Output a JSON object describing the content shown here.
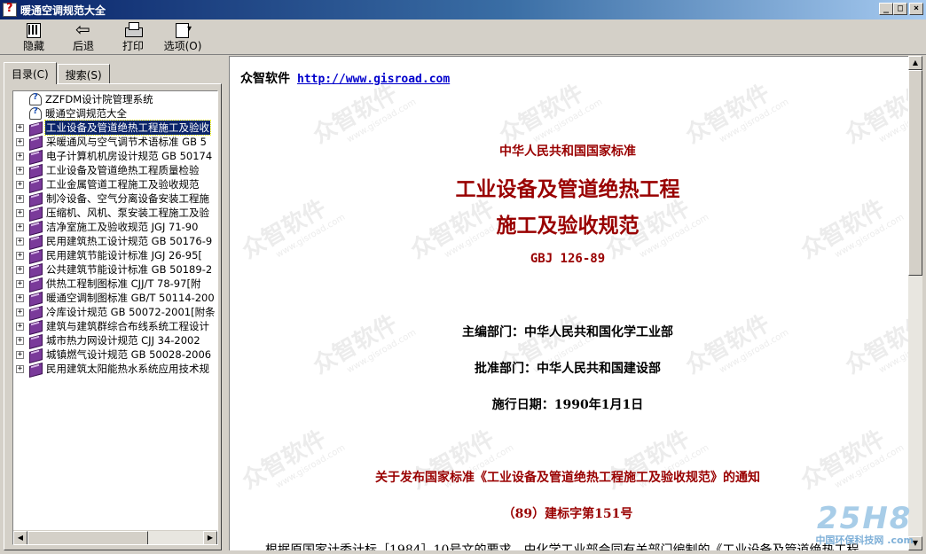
{
  "window": {
    "title": "暖通空调规范大全",
    "controls": [
      "_",
      "□",
      "×"
    ]
  },
  "toolbar": {
    "hide_label": "隐藏",
    "back_label": "后退",
    "print_label": "打印",
    "options_label": "选项(O)"
  },
  "left_panel": {
    "tabs": [
      {
        "label": "目录(C)",
        "active": true
      },
      {
        "label": "搜索(S)",
        "active": false
      }
    ],
    "tree_items": [
      {
        "label": "ZZFDM设计院管理系统",
        "kind": "page"
      },
      {
        "label": "暖通空调规范大全",
        "kind": "page"
      },
      {
        "label": "工业设备及管道绝热工程施工及验收",
        "kind": "book",
        "selected": true
      },
      {
        "label": "采暖通风与空气调节术语标准 GB 5",
        "kind": "book"
      },
      {
        "label": "电子计算机机房设计规范 GB 50174",
        "kind": "book"
      },
      {
        "label": "工业设备及管道绝热工程质量检验",
        "kind": "book"
      },
      {
        "label": "工业金属管道工程施工及验收规范",
        "kind": "book"
      },
      {
        "label": "制冷设备、空气分离设备安装工程施",
        "kind": "book"
      },
      {
        "label": "压缩机、风机、泵安装工程施工及验",
        "kind": "book"
      },
      {
        "label": "洁净室施工及验收规范 JGJ 71-90",
        "kind": "book"
      },
      {
        "label": "民用建筑热工设计规范 GB 50176-9",
        "kind": "book"
      },
      {
        "label": "民用建筑节能设计标准 JGJ 26-95[",
        "kind": "book"
      },
      {
        "label": "公共建筑节能设计标准 GB 50189-2",
        "kind": "book"
      },
      {
        "label": "供热工程制图标准 CJJ/T 78-97[附",
        "kind": "book"
      },
      {
        "label": "暖通空调制图标准 GB/T 50114-200",
        "kind": "book"
      },
      {
        "label": "冷库设计规范 GB 50072-2001[附条",
        "kind": "book"
      },
      {
        "label": "建筑与建筑群综合布线系统工程设计",
        "kind": "book"
      },
      {
        "label": "城市热力网设计规范 CJJ 34-2002",
        "kind": "book"
      },
      {
        "label": "城镇燃气设计规范 GB 50028-2006",
        "kind": "book"
      },
      {
        "label": "民用建筑太阳能热水系统应用技术规",
        "kind": "book"
      }
    ]
  },
  "document": {
    "brand": "众智软件",
    "url": "http://www.gisroad.com",
    "standard_type": "中华人民共和国国家标准",
    "title_line1": "工业设备及管道绝热工程",
    "title_line2": "施工及验收规范",
    "code": "GBJ 126-89",
    "editor_dept": "主编部门：中华人民共和国化学工业部",
    "approve_dept": "批准部门：中华人民共和国建设部",
    "effective_date": "施行日期：1990年1月1日",
    "notice_title": "关于发布国家标准《工业设备及管道绝热工程施工及验收规范》的通知",
    "notice_code": "（89）建标字第151号",
    "body_start": "根据原国家计委计标［1984］10号文的要求，由化学工业部会同有关部门编制的《工业设备及管道绝热工程",
    "watermark_text": "众智软件",
    "watermark_url": "www.gisroad.com"
  },
  "overlay_logo": {
    "big": "25H8",
    "sub": "中国环保科技网 .com"
  },
  "colors": {
    "title_bar_start": "#0a246a",
    "title_bar_end": "#a6caf0",
    "doc_red": "#990000",
    "link": "#0000cc",
    "selected": "#0a246a"
  }
}
